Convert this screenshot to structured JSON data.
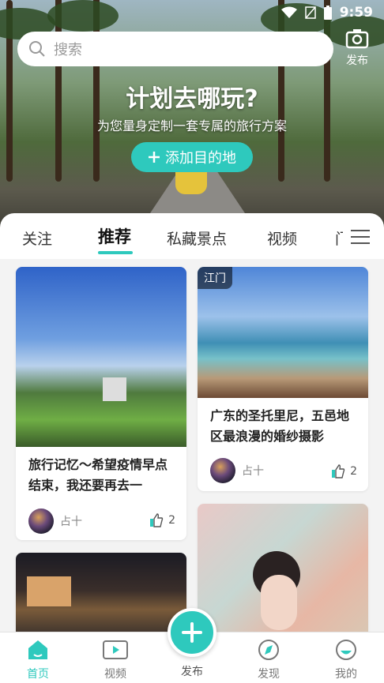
{
  "status": {
    "time": "9:59"
  },
  "search": {
    "placeholder": "搜索"
  },
  "top_publish": {
    "label": "发布"
  },
  "hero": {
    "title": "计划去哪玩?",
    "subtitle": "为您量身定制一套专属的旅行方案",
    "cta": "添加目的地"
  },
  "tabs": [
    {
      "label": "关注"
    },
    {
      "label": "推荐",
      "active": true
    },
    {
      "label": "私藏景点"
    },
    {
      "label": "视频"
    },
    {
      "label": "门"
    }
  ],
  "cards": [
    {
      "title": "旅行记忆～希望疫情早点结束，我还要再去一",
      "user": "占十",
      "likes": "2"
    },
    {
      "tag": "江门",
      "title": "广东的圣托里尼，五邑地区最浪漫的婚纱摄影",
      "user": "占十",
      "likes": "2"
    }
  ],
  "nav": [
    {
      "label": "首页",
      "icon": "home-icon",
      "active": true
    },
    {
      "label": "视频",
      "icon": "video-icon"
    },
    {
      "label": "发布",
      "icon": "plus-icon"
    },
    {
      "label": "发现",
      "icon": "compass-icon"
    },
    {
      "label": "我的",
      "icon": "profile-icon"
    }
  ],
  "colors": {
    "accent": "#2ec9bd"
  }
}
